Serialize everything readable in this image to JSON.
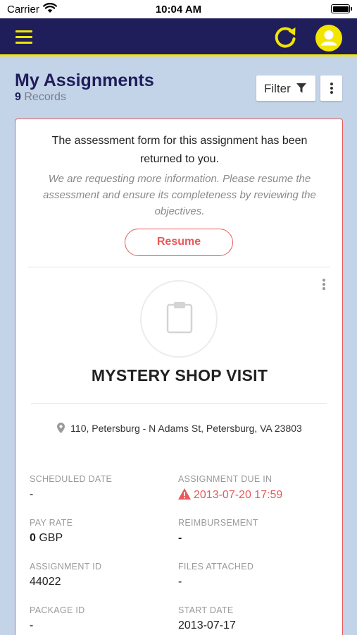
{
  "status_bar": {
    "carrier": "Carrier",
    "time": "10:04 AM"
  },
  "colors": {
    "navy": "#1f1d5a",
    "accent_yellow": "#f2e600",
    "alert_red": "#e8595a",
    "background": "#c3d3e8"
  },
  "navbar": {
    "icons": [
      "menu-icon",
      "refresh-icon",
      "user-avatar-icon"
    ]
  },
  "header": {
    "title": "My Assignments",
    "record_count": "9",
    "records_label": "Records",
    "filter_label": "Filter"
  },
  "assignment": {
    "returned_message": "The assessment form for this assignment has been returned to you.",
    "returned_note": "We are requesting more information. Please resume the assessment and ensure its completeness by reviewing the objectives.",
    "resume_label": "Resume",
    "title": "MYSTERY SHOP VISIT",
    "address": "110, Petersburg - N Adams St, Petersburg, VA 23803",
    "fields": {
      "scheduled_date": {
        "label": "SCHEDULED DATE",
        "value": "-"
      },
      "due_in": {
        "label": "ASSIGNMENT DUE IN",
        "value": "2013-07-20 17:59"
      },
      "pay_rate": {
        "label": "PAY RATE",
        "amount": "0",
        "currency": "GBP"
      },
      "reimbursement": {
        "label": "REIMBURSEMENT",
        "value": "-"
      },
      "assignment_id": {
        "label": "ASSIGNMENT ID",
        "value": "44022"
      },
      "files_attached": {
        "label": "FILES ATTACHED",
        "value": "-"
      },
      "package_id": {
        "label": "PACKAGE ID",
        "value": "-"
      },
      "start_date": {
        "label": "START DATE",
        "value": "2013-07-17"
      }
    }
  }
}
